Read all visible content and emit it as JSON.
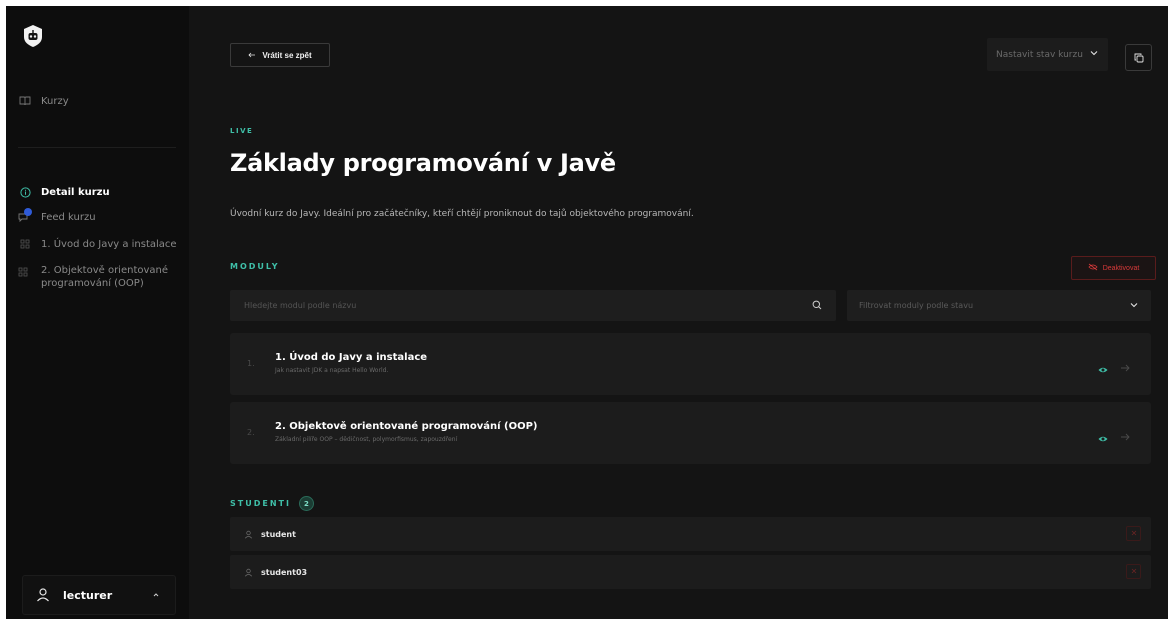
{
  "sidebar": {
    "courses_label": "Kurzy",
    "nav": {
      "detail": "Detail kurzu",
      "feed": "Feed kurzu",
      "module1": "1. Úvod do Javy a instalace",
      "module2_line1": "2. Objektově orientované",
      "module2_line2": "programování (OOP)"
    },
    "user": {
      "name": "lecturer"
    }
  },
  "header": {
    "back_label": "Vrátit se zpět",
    "state_label": "Nastavit stav kurzu"
  },
  "course": {
    "status": "LIVE",
    "title": "Základy programování v Javě",
    "description": "Úvodní kurz do Javy. Ideální pro začátečníky, kteří chtějí proniknout do tajů objektového programování."
  },
  "modules_section": {
    "label": "MODULY",
    "deactivate_label": "Deaktivovat",
    "search_placeholder": "Hledejte modul podle názvu",
    "filter_placeholder": "Filtrovat moduly podle stavu",
    "items": [
      {
        "num": "1.",
        "title": "1. Úvod do Javy a instalace",
        "subtitle": "Jak nastavit JDK a napsat Hello World."
      },
      {
        "num": "2.",
        "title": "2. Objektově orientované programování (OOP)",
        "subtitle": "Základní pilíře OOP – dědičnost, polymorfismus, zapouzdření"
      }
    ]
  },
  "students_section": {
    "label": "STUDENTI",
    "count": "2",
    "items": [
      {
        "name": "student"
      },
      {
        "name": "student03"
      }
    ]
  },
  "colors": {
    "accent": "#3fbfa8",
    "danger": "#d83a3a",
    "background": "#141414",
    "sidebar": "#0d0d0d"
  },
  "icons": {
    "logo": "robot-badge-icon",
    "courses": "book-icon",
    "detail": "info-circle-icon",
    "feed": "chat-bubble-icon",
    "module": "grid-icon",
    "user": "person-icon",
    "search": "search-icon",
    "visible": "eye-icon",
    "go": "arrow-right-icon",
    "remove": "close-icon"
  }
}
